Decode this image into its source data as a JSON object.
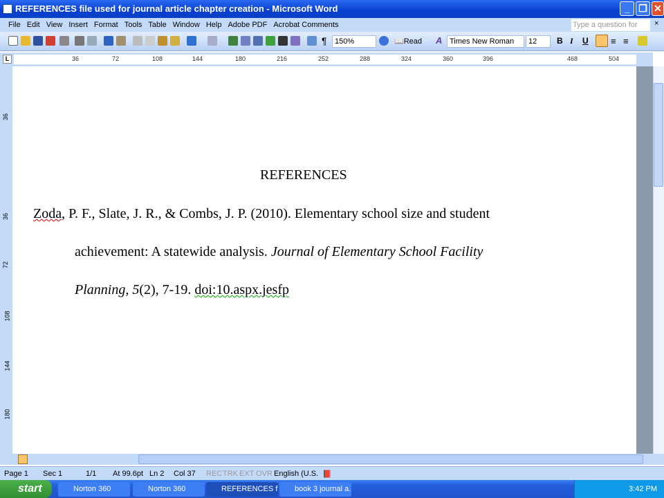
{
  "window": {
    "title": "REFERENCES file used for journal article chapter creation - Microsoft Word"
  },
  "menu": [
    "File",
    "Edit",
    "View",
    "Insert",
    "Format",
    "Tools",
    "Table",
    "Window",
    "Help",
    "Adobe PDF",
    "Acrobat Comments"
  ],
  "help_placeholder": "Type a question for help",
  "toolbar": {
    "zoom": "150%",
    "read": "Read",
    "font": "Times New Roman",
    "size": "12",
    "bold": "B",
    "italic": "I",
    "underline": "U"
  },
  "ruler": {
    "h_ticks": [
      "36",
      "72",
      "108",
      "144",
      "180",
      "216",
      "252",
      "288",
      "324",
      "360",
      "396",
      "468",
      "504"
    ],
    "v_ticks": [
      "36",
      "36",
      "72",
      "108",
      "144",
      "180"
    ]
  },
  "document": {
    "heading": "REFERENCES",
    "ref_author": "Zoda",
    "ref_line1_rest": ", P. F., Slate, J. R., & Combs, J. P. (2010). Elementary school size and student",
    "ref_line2_plain": "achievement: A statewide analysis. ",
    "ref_line2_italic": "Journal of Elementary School Facility",
    "ref_line3_italic1": "Planning, 5",
    "ref_line3_plain": "(2), 7-19. ",
    "ref_doi": "doi:10.aspx.jesfp"
  },
  "status": {
    "page": "Page 1",
    "sec": "Sec 1",
    "pages": "1/1",
    "at": "At 99.6pt",
    "ln": "Ln 2",
    "col": "Col 37",
    "rec": "REC",
    "trk": "TRK",
    "ext": "EXT",
    "ovr": "OVR",
    "lang": "English (U.S."
  },
  "taskbar": {
    "start": "start",
    "tasks": [
      "Norton 360",
      "Norton 360",
      "REFERENCES fil...",
      "book 3 journal a..."
    ],
    "clock": "3:42 PM"
  }
}
